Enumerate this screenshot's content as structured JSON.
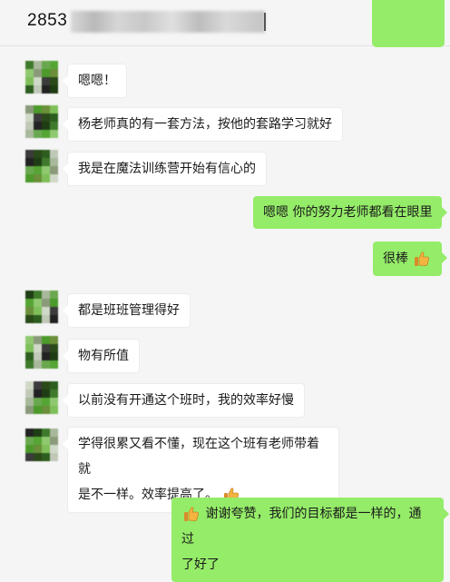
{
  "header": {
    "title": "2853"
  },
  "avatar_colors": [
    "#3f7a2c",
    "#6b8f3a",
    "#222222",
    "#8a9a7a",
    "#2e5e1f",
    "#55a535",
    "#3b3b3b",
    "#a8b89a",
    "#7fbf5a",
    "#1f3d14",
    "#4c9a2a",
    "#c0c8b8",
    "#90c870",
    "#2a4a1a",
    "#6aa84f",
    "#d0d8c8"
  ],
  "messages": [
    {
      "side": "left",
      "text": "嗯嗯！"
    },
    {
      "side": "left",
      "text": "杨老师真的有一套方法，按他的套路学习就好"
    },
    {
      "side": "left",
      "text": "我是在魔法训练营开始有信心的"
    },
    {
      "side": "right",
      "text": "嗯嗯  你的努力老师都看在眼里"
    },
    {
      "side": "right",
      "text": "很棒",
      "emoji": "thumbs-up-icon"
    },
    {
      "side": "left",
      "text": "都是班班管理得好"
    },
    {
      "side": "left",
      "text": "物有所值"
    },
    {
      "side": "left",
      "text": "以前没有开通这个班时，我的效率好慢"
    },
    {
      "side": "left",
      "text_line1": "学得很累又看不懂，现在这个班有老师带着就",
      "text_line2": "是不一样。效率提高了。",
      "emoji": "thumbs-up-icon"
    },
    {
      "side": "right",
      "text_line1": "谢谢夸赞，我们的目标都是一样的，通过",
      "text_line2": "了好了",
      "emoji": "thumbs-up-icon"
    }
  ]
}
